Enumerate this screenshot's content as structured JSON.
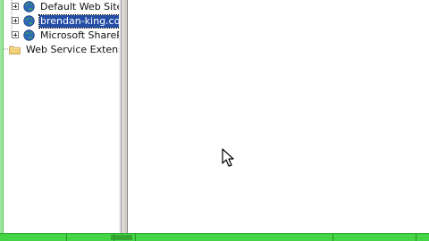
{
  "tree": {
    "items": [
      {
        "label": "Default Web Site",
        "icon": "globe-icon",
        "expanded": false,
        "selected": false
      },
      {
        "label": "brendan-king.com",
        "icon": "globe-icon",
        "expanded": false,
        "selected": true
      },
      {
        "label": "Microsoft SharePoi",
        "icon": "globe-icon",
        "expanded": false,
        "selected": false
      },
      {
        "label": "Web Service Extension",
        "icon": "folder-icon",
        "expanded": false,
        "selected": false
      }
    ]
  },
  "colors": {
    "selection_bg": "#244ea5",
    "selection_text": "#ffffff",
    "status_green": "#45d446",
    "window_green": "#9ee39f",
    "folder_yellow": "#f3d17a",
    "globe_blue": "#2f68b8",
    "globe_green": "#3aa25a"
  }
}
